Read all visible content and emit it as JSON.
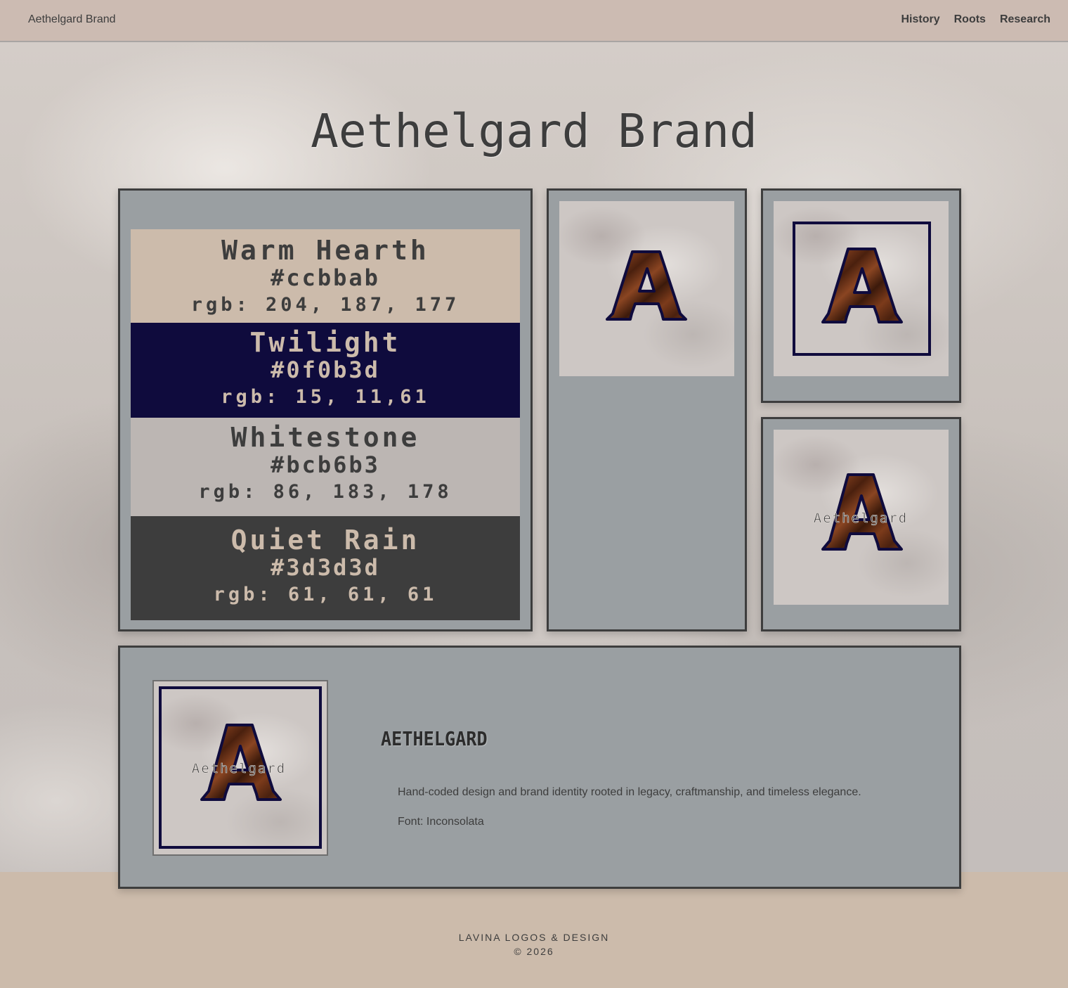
{
  "nav": {
    "brand": "Aethelgard Brand",
    "links": [
      "History",
      "Roots",
      "Research"
    ]
  },
  "page": {
    "title": "Aethelgard Brand"
  },
  "palette": [
    {
      "name": "Warm Hearth",
      "hex": "#ccbbab",
      "rgb": "rgb: 204, 187, 177"
    },
    {
      "name": "Twilight",
      "hex": "#0f0b3d",
      "rgb": "rgb: 15, 11,61"
    },
    {
      "name": "Whitestone",
      "hex": "#bcb6b3",
      "rgb": "rgb: 86, 183, 178"
    },
    {
      "name": "Quiet Rain",
      "hex": "#3d3d3d",
      "rgb": "rgb: 61, 61, 61"
    }
  ],
  "logos": {
    "monogram_letter": "A",
    "wordmark": "Aethelgard"
  },
  "info": {
    "heading": "AETHELGARD",
    "description": "Hand-coded design and brand identity rooted in legacy, craftmanship, and timeless elegance.",
    "font": "Font: Inconsolata"
  },
  "footer": {
    "studio": "LAVINA LOGOS & DESIGN",
    "copyright": "© 2026"
  },
  "colors": {
    "warm_hearth": "#ccbbab",
    "twilight": "#0f0b3d",
    "whitestone": "#bcb6b3",
    "quiet_rain": "#3d3d3d",
    "card_bg": "#9a9fa2"
  }
}
